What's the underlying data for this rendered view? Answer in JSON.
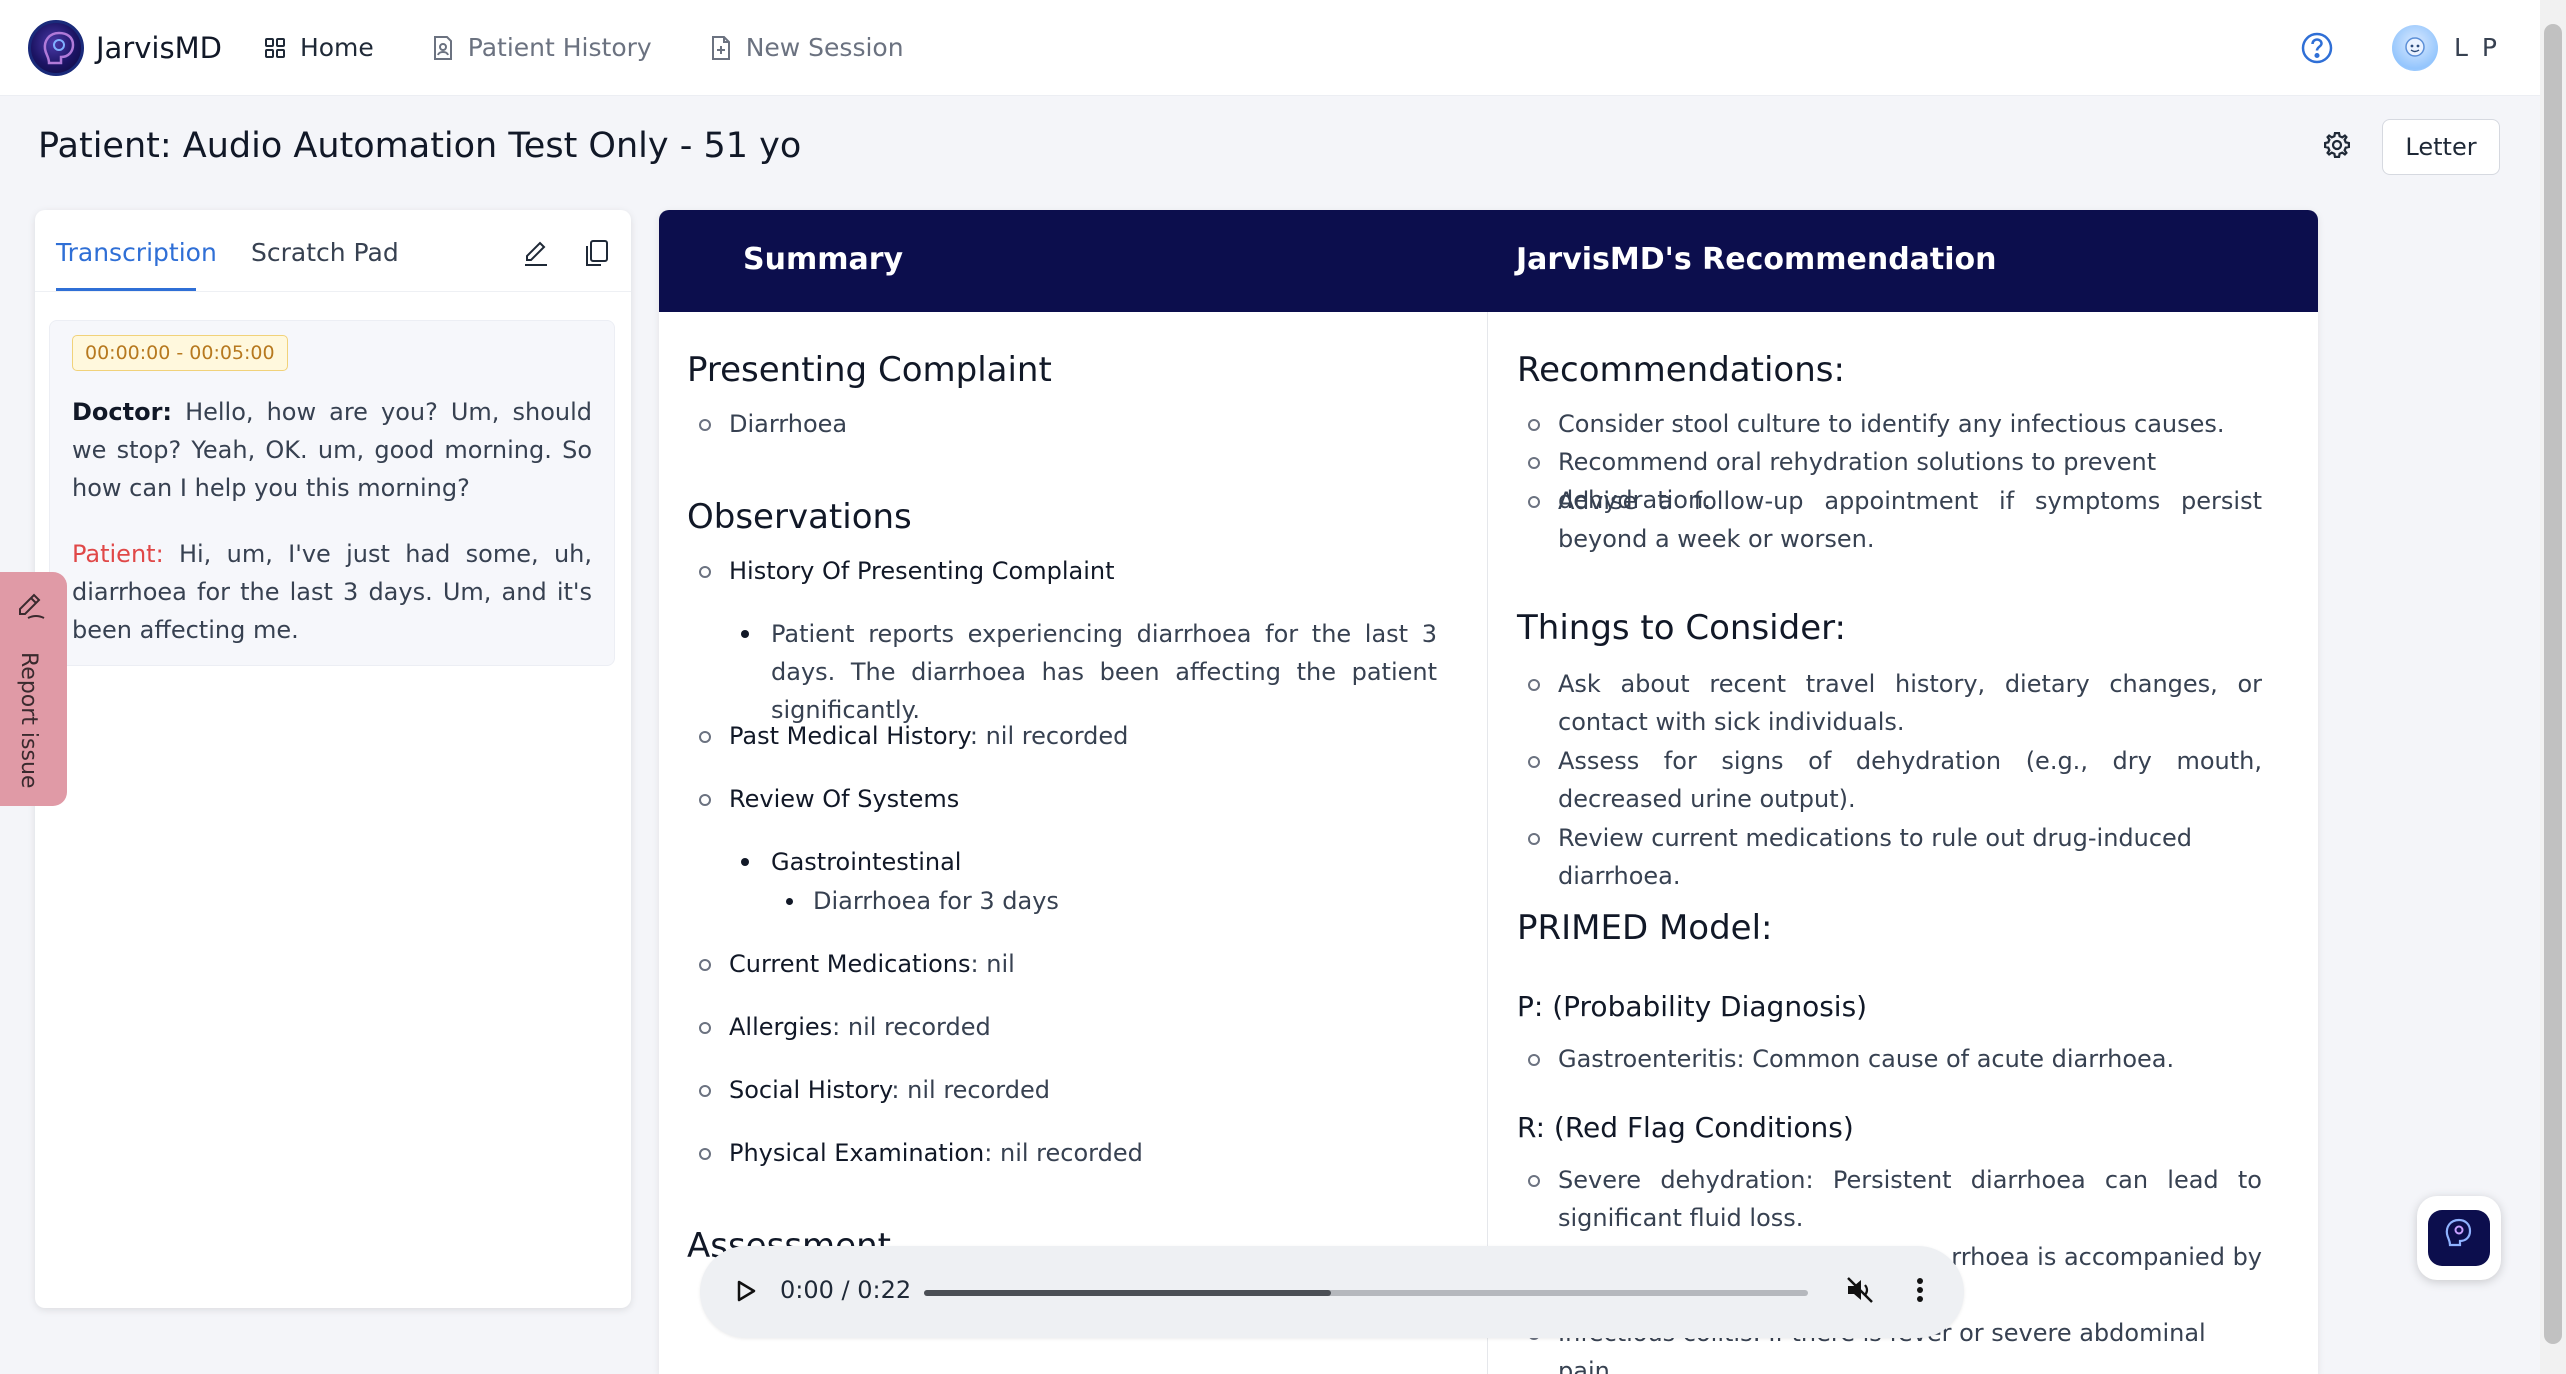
{
  "app": {
    "logo_text": "JarvisMD",
    "nav": [
      {
        "label": "Home",
        "icon": "grid-icon"
      },
      {
        "label": "Patient History",
        "icon": "document-person-icon"
      },
      {
        "label": "New Session",
        "icon": "document-add-icon"
      }
    ],
    "user_initials": "L P"
  },
  "patient": {
    "title": "Patient: Audio Automation Test Only - 51 yo",
    "letter_label": "Letter"
  },
  "left_panel": {
    "tabs": [
      "Transcription",
      "Scratch Pad"
    ],
    "active_tab": "Transcription",
    "time_range": "00:00:00 - 00:05:00",
    "utterances": [
      {
        "speaker": "Doctor:",
        "text": " Hello, how are you? Um, should we stop? Yeah, OK. um, good morning. So how can I help you this morning?"
      },
      {
        "speaker": "Patient:",
        "text": " Hi, um, I've just had some, uh, diarrhoea for the last 3 days. Um, and it's been affecting me."
      }
    ]
  },
  "report_issue": {
    "label": "Report issue"
  },
  "main": {
    "summary_header": "Summary",
    "rec_header": "JarvisMD's Recommendation",
    "summary": {
      "presenting_complaint_title": "Presenting Complaint",
      "presenting_complaint": "Diarrhoea",
      "observations_title": "Observations",
      "hopc_label": "History Of Presenting Complaint",
      "hopc_text": "Patient reports experiencing diarrhoea for the last 3 days. The diarrhoea has been affecting the patient significantly.",
      "pmh_label": "Past Medical History",
      "pmh_value": ": nil recorded",
      "ros_label": "Review Of Systems",
      "ros_system": "Gastrointestinal",
      "ros_item": "Diarrhoea for 3 days",
      "meds_label": "Current Medications",
      "meds_value": ": nil",
      "allergies_label": "Allergies",
      "allergies_value": ": nil recorded",
      "social_label": "Social History",
      "social_value": ": nil recorded",
      "exam_label": "Physical Examination",
      "exam_value": ": nil recorded",
      "assessment_title": "Assessment"
    },
    "recommendation": {
      "rec_title": "Recommendations:",
      "rec_items": [
        "Consider stool culture to identify any infectious causes.",
        "Recommend oral rehydration solutions to prevent dehydration.",
        "Advise a follow-up appointment if symptoms persist beyond a week or worsen."
      ],
      "consider_title": "Things to Consider:",
      "consider_items": [
        "Ask about recent travel history, dietary changes, or contact with sick individuals.",
        "Assess for signs of dehydration (e.g., dry mouth, decreased urine output).",
        "Review current medications to rule out drug-induced diarrhoea."
      ],
      "primed_title": "PRIMED Model:",
      "p_title": "P: (Probability Diagnosis)",
      "p_item": "Gastroenteritis: Common cause of acute diarrhoea.",
      "r_title": "R: (Red Flag Conditions)",
      "r_item1": "Severe dehydration: Persistent diarrhoea can lead to significant fluid loss.",
      "r_item2_partial": "rrhoea is accompanied by",
      "r_item3": "Infectious colitis: If there is fever or severe abdominal pain."
    }
  },
  "audio": {
    "time": "0:00 / 0:22",
    "progress": 0.46
  },
  "colors": {
    "brand_navy": "#0c0e4d",
    "accent_blue": "#2f6fd6",
    "patient_red": "#e04848",
    "report_pink": "#e09aa6"
  }
}
